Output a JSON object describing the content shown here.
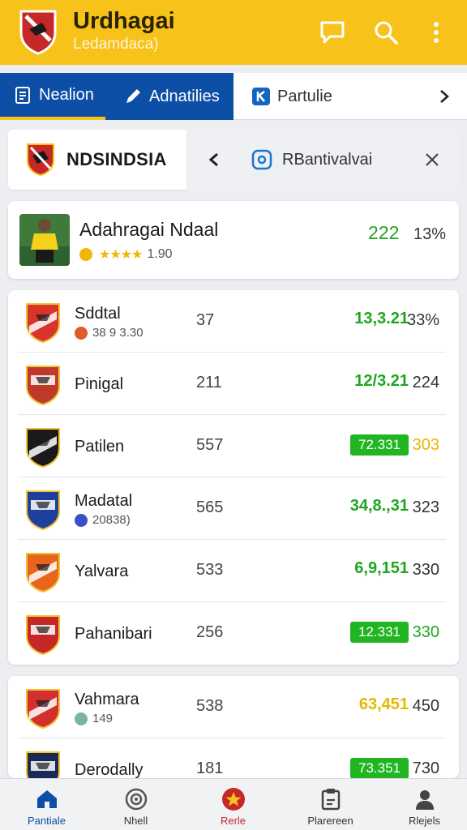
{
  "app": {
    "title": "Urdhagai",
    "subtitle": "Ledamdaca)"
  },
  "tabs": [
    {
      "label": "Nealion",
      "icon": "clipboard-icon"
    },
    {
      "label": "Adnatilies",
      "icon": "pencil-icon"
    },
    {
      "label": "Partulie",
      "icon": "k-badge-icon"
    }
  ],
  "filter": {
    "team_name": "NDSINDSIA",
    "chip_label": "RBantivalvai"
  },
  "featured": {
    "name": "Adahragai Ndaal",
    "rating_text": "1.90",
    "stars": "★★★★",
    "score": "222",
    "percent": "13%"
  },
  "rows": [
    {
      "name": "Sddtal",
      "sub": "38 9 3.30",
      "num": "37",
      "value": "13,3.21",
      "value_style": "green",
      "last": "33%",
      "last_style": "dark",
      "crest_color": "#d9342b",
      "sub_color": "#e05a2a"
    },
    {
      "name": "Pinigal",
      "sub": "",
      "num": "211",
      "value": "12/3.21",
      "value_style": "green",
      "last": "224",
      "last_style": "dark",
      "crest_color": "#c0392b",
      "sub_color": ""
    },
    {
      "name": "Patilen",
      "sub": "",
      "num": "557",
      "value": "72.331",
      "value_style": "badge",
      "last": "303",
      "last_style": "yellow",
      "crest_color": "#1a1a1a",
      "sub_color": ""
    },
    {
      "name": "Madatal",
      "sub": "20838)",
      "num": "565",
      "value": "34,8.,31",
      "value_style": "green",
      "last": "323",
      "last_style": "dark",
      "crest_color": "#1d3f9e",
      "sub_color": "#3a50c9"
    },
    {
      "name": "Yalvara",
      "sub": "",
      "num": "533",
      "value": "6,9,151",
      "value_style": "green",
      "last": "330",
      "last_style": "dark",
      "crest_color": "#e8651b",
      "sub_color": ""
    },
    {
      "name": "Pahanibari",
      "sub": "",
      "num": "256",
      "value": "12.331",
      "value_style": "badge",
      "last": "330",
      "last_style": "green",
      "crest_color": "#c62828",
      "sub_color": ""
    }
  ],
  "rows2": [
    {
      "name": "Vahmara",
      "sub": "149",
      "num": "538",
      "value": "63,451",
      "value_style": "yellow",
      "last": "450",
      "last_style": "dark",
      "crest_color": "#d32f2f",
      "sub_color": "#7bb3a8"
    },
    {
      "name": "Derodally",
      "sub": "",
      "num": "181",
      "value": "73.351",
      "value_style": "badge",
      "last": "730",
      "last_style": "dark",
      "crest_color": "#1a2a55",
      "sub_color": ""
    }
  ],
  "bottom_nav": [
    {
      "label": "Pantiale",
      "icon": "home-icon"
    },
    {
      "label": "Nhell",
      "icon": "target-icon"
    },
    {
      "label": "Rerle",
      "icon": "star-icon"
    },
    {
      "label": "Plarereen",
      "icon": "clipboard-check-icon"
    },
    {
      "label": "Rlejels",
      "icon": "person-icon"
    }
  ],
  "colors": {
    "accent_yellow": "#f7c21a",
    "accent_blue": "#0d4ea6",
    "positive_green": "#1fa61f"
  }
}
